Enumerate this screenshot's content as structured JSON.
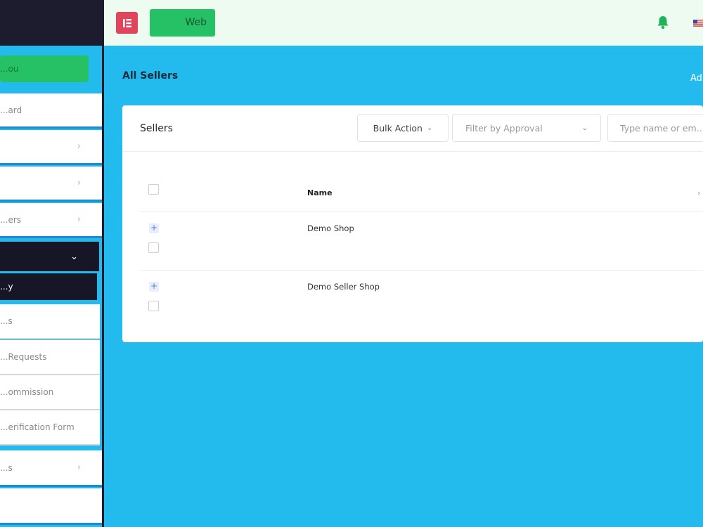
{
  "topbar": {
    "web_label": "Web"
  },
  "sidebar": {
    "cta_label": "...ou",
    "items": [
      {
        "label": "...ard"
      },
      {
        "label": ""
      },
      {
        "label": ""
      },
      {
        "label": "...ers"
      },
      {
        "label": ""
      },
      {
        "label": "...s"
      },
      {
        "label": ""
      }
    ],
    "sub_items": [
      {
        "label": "...y"
      },
      {
        "label": "...s"
      },
      {
        "label": "...Requests"
      },
      {
        "label": "...ommission"
      },
      {
        "label": "...erification Form"
      }
    ]
  },
  "page": {
    "title": "All Sellers",
    "add_link": "Ad..."
  },
  "card": {
    "title": "Sellers",
    "bulk_action": "Bulk Action",
    "filter_placeholder": "Filter by Approval",
    "search_placeholder": "Type name or em...",
    "columns": {
      "name": "Name"
    },
    "rows": [
      {
        "name": "Demo Shop"
      },
      {
        "name": "Demo Seller Shop"
      }
    ]
  },
  "colors": {
    "background": "#23bbee",
    "sidebar_dark": "#161626",
    "accent_green": "#27c165",
    "elementor_red": "#e2445c",
    "bell_green": "#1fb45a"
  }
}
